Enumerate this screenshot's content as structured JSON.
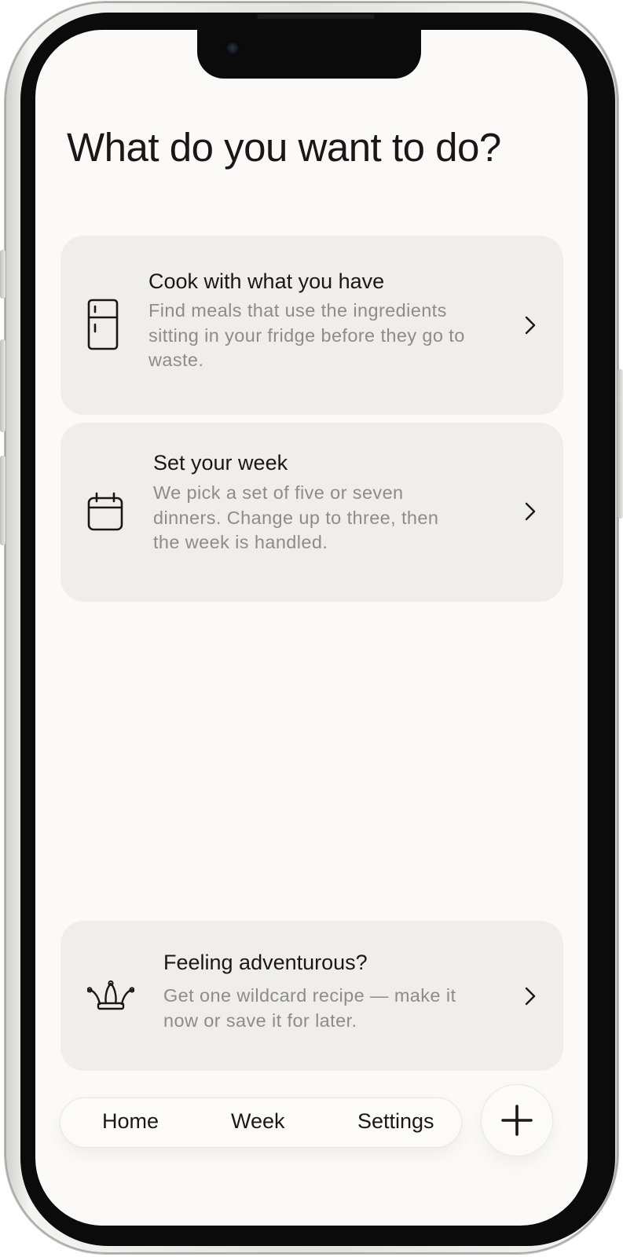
{
  "page": {
    "title": "What do you want to do?"
  },
  "cards": [
    {
      "icon": "fridge-icon",
      "title": "Cook with what you have",
      "description": "Find meals that use the ingredients sitting in your fridge before they go to waste."
    },
    {
      "icon": "calendar-icon",
      "title": "Set your week",
      "description": "We pick a set of five or seven dinners. Change up to three, then the week is handled."
    },
    {
      "icon": "jester-hat-icon",
      "title": "Feeling adventurous?",
      "description": "Get one wildcard recipe — make it now or save it for later."
    }
  ],
  "tabbar": {
    "tabs": [
      {
        "label": "Home"
      },
      {
        "label": "Week"
      },
      {
        "label": "Settings"
      }
    ],
    "fab_icon": "plus-icon"
  },
  "colors": {
    "background": "#fbfaf8",
    "card": "#efeeed",
    "text": "#1d1616",
    "muted_text": "#8e8b8b"
  }
}
